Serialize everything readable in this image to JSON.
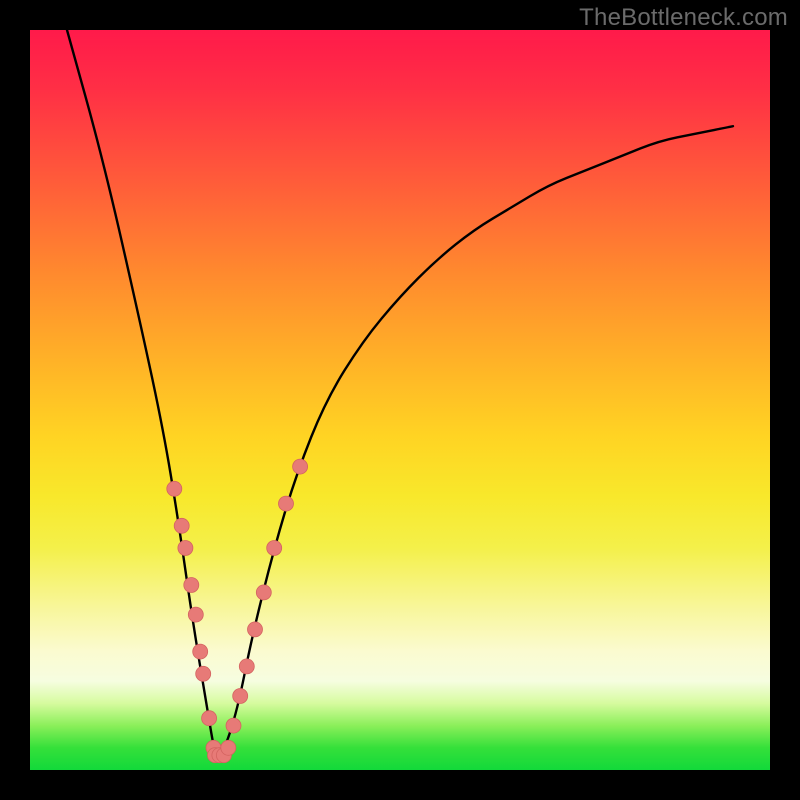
{
  "watermark": "TheBottleneck.com",
  "colors": {
    "frame": "#000000",
    "gradient_stops": [
      "#ff1a4a",
      "#ff2f45",
      "#ff5a3a",
      "#ff8a2e",
      "#ffb327",
      "#ffd423",
      "#f8e82b",
      "#f4f04a",
      "#f8f69a",
      "#fbfbd0",
      "#f6fde0",
      "#d6fb9e",
      "#8bef5a",
      "#35e03a",
      "#12d93a"
    ],
    "curve": "#000000",
    "dot_fill": "#e77a77",
    "dot_stroke": "#d46360"
  },
  "chart_data": {
    "type": "line",
    "title": "",
    "xlabel": "",
    "ylabel": "",
    "xlim": [
      0,
      100
    ],
    "ylim": [
      0,
      100
    ],
    "grid": false,
    "series": [
      {
        "name": "bottleneck_curve",
        "note": "approx V-shaped curve; y estimated from vertical position (0 bottom = green, 100 top = red)",
        "x": [
          5,
          10,
          15,
          18,
          20,
          22,
          24,
          25,
          26,
          28,
          30,
          33,
          36,
          40,
          45,
          50,
          55,
          60,
          65,
          70,
          75,
          80,
          85,
          90,
          95
        ],
        "y": [
          100,
          82,
          60,
          46,
          34,
          20,
          8,
          2,
          2,
          8,
          18,
          30,
          40,
          50,
          58,
          64,
          69,
          73,
          76,
          79,
          81,
          83,
          85,
          86,
          87
        ]
      }
    ],
    "markers": [
      {
        "name": "highlighted_points_left_branch",
        "note": "salmon dots along lower-left limb of V",
        "x": [
          19.5,
          20.5,
          21.0,
          21.8,
          22.4,
          23.0,
          23.4,
          24.2,
          24.8
        ],
        "y": [
          38,
          33,
          30,
          25,
          21,
          16,
          13,
          7,
          3
        ]
      },
      {
        "name": "highlighted_points_bottom",
        "note": "salmon dots across valley floor",
        "x": [
          25.0,
          25.6,
          26.2,
          26.8
        ],
        "y": [
          2,
          2,
          2,
          3
        ]
      },
      {
        "name": "highlighted_points_right_branch",
        "note": "salmon dots along lower-right limb of V",
        "x": [
          27.5,
          28.4,
          29.3,
          30.4,
          31.6,
          33.0,
          34.6,
          36.5
        ],
        "y": [
          6,
          10,
          14,
          19,
          24,
          30,
          36,
          41
        ]
      }
    ]
  }
}
